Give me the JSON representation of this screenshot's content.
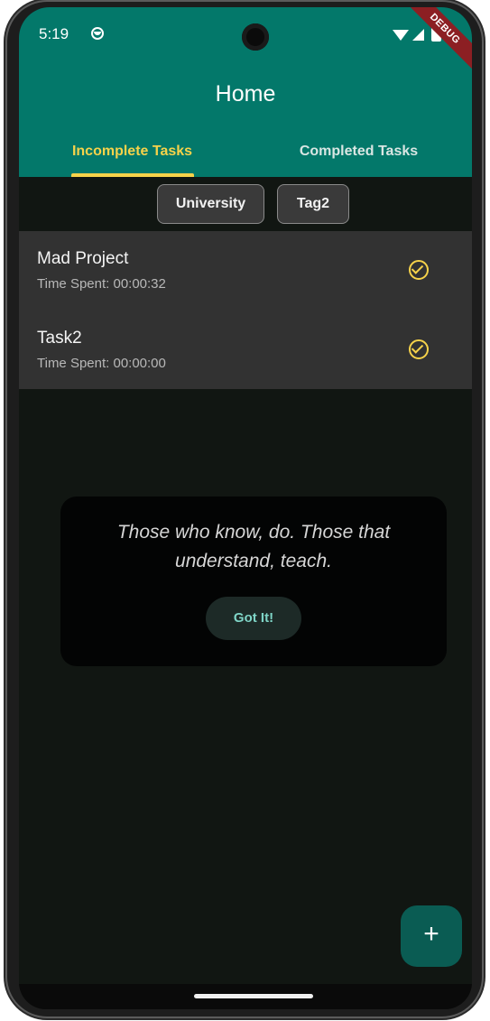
{
  "status_bar": {
    "time": "5:19"
  },
  "debug_banner": "DEBUG",
  "app_bar": {
    "title": "Home"
  },
  "tabs": [
    {
      "label": "Incomplete Tasks",
      "selected": true
    },
    {
      "label": "Completed Tasks",
      "selected": false
    }
  ],
  "filter_chips": [
    {
      "label": "University"
    },
    {
      "label": "Tag2"
    }
  ],
  "tasks": [
    {
      "title": "Mad Project",
      "subtitle": "Time Spent: 00:00:32"
    },
    {
      "title": "Task2",
      "subtitle": "Time Spent: 00:00:00"
    }
  ],
  "dialog": {
    "quote": "Those who know, do. Those that understand, teach.",
    "button_label": "Got It!"
  },
  "fab": {
    "icon": "plus-icon"
  },
  "colors": {
    "app_bar": "#03786a",
    "accent": "#f6d24a",
    "background": "#111612",
    "task_list": "#323232",
    "fab": "#0a5c53"
  }
}
